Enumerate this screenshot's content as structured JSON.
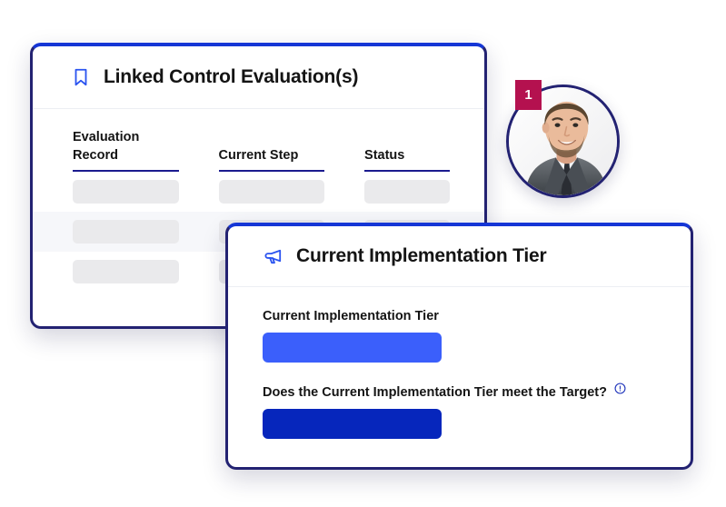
{
  "cards": {
    "linked_control": {
      "icon": "bookmark-icon",
      "title": "Linked Control Evaluation(s)",
      "table": {
        "columns": [
          "Evaluation Record",
          "Current Step",
          "Status"
        ],
        "rows": [
          {
            "cells": [
              "",
              "",
              ""
            ]
          },
          {
            "cells": [
              "",
              "",
              ""
            ]
          },
          {
            "cells": [
              "",
              "",
              ""
            ]
          }
        ]
      }
    },
    "implementation_tier": {
      "icon": "megaphone-icon",
      "title": "Current Implementation Tier",
      "fields": [
        {
          "label": "Current Implementation Tier",
          "value": "",
          "bar_color": "#3b5ffb",
          "has_info": false
        },
        {
          "label": "Does the Current Implementation Tier meet the Target?",
          "value": "",
          "bar_color": "#0626bc",
          "has_info": true
        }
      ]
    }
  },
  "avatar": {
    "badge_count": "1",
    "badge_color": "#b4114f",
    "border_color": "#232272",
    "alt": "user-profile-photo"
  },
  "theme": {
    "accent_blue": "#1536d6",
    "border_navy": "#232272",
    "underline_navy": "#1b1b8f",
    "skeleton_gray": "#eaeaec",
    "row_alt_gray": "#f6f7fa"
  }
}
